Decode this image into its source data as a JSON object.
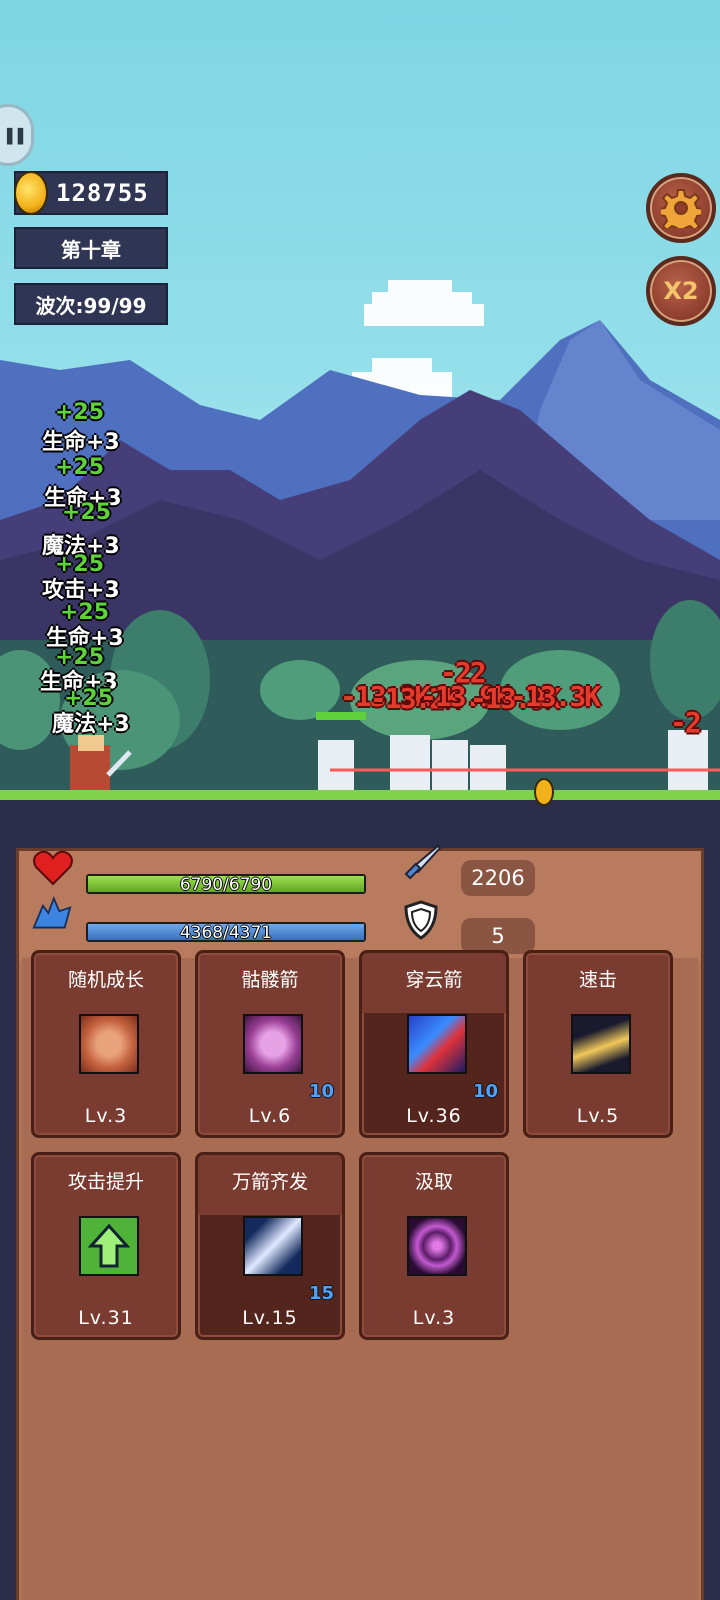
{
  "hud": {
    "coins": "128755",
    "chapter": "第十章",
    "wave": "波次:99/99",
    "speed_button": "X2"
  },
  "float_texts": [
    "+25",
    "生命+3",
    "+25",
    "生命+3",
    "+25",
    "魔法+3",
    "+25",
    "攻击+3",
    "+25",
    "生命+3",
    "+25",
    "生命+3",
    "+25",
    "魔法+3"
  ],
  "damage_texts": [
    "-22",
    "-13.3K",
    "-13.2K",
    "-13.9K",
    "-13.9K",
    "-13.3K",
    "-2"
  ],
  "stats": {
    "hp_text": "6790/6790",
    "hp_fraction": 1.0,
    "mp_text": "4368/4371",
    "mp_fraction": 0.999,
    "attack": "2206",
    "defense": "5"
  },
  "skills": [
    {
      "name": "随机成长",
      "level": "Lv.3",
      "badge": "",
      "icon": "fist-icon"
    },
    {
      "name": "骷髅箭",
      "level": "Lv.6",
      "badge": "10",
      "icon": "skull-icon"
    },
    {
      "name": "穿云箭",
      "level": "Lv.36",
      "badge": "10",
      "icon": "arrow-icon"
    },
    {
      "name": "速击",
      "level": "Lv.5",
      "badge": "",
      "icon": "swift-boot-icon"
    },
    {
      "name": "攻击提升",
      "level": "Lv.31",
      "badge": "",
      "icon": "up-arrow-icon"
    },
    {
      "name": "万箭齐发",
      "level": "Lv.15",
      "badge": "15",
      "icon": "feather-icon"
    },
    {
      "name": "汲取",
      "level": "Lv.3",
      "badge": "",
      "icon": "vortex-icon"
    }
  ],
  "colors": {
    "hp": "#7cc23a",
    "mp": "#4d86d4",
    "damage": "#e43b2c",
    "heal": "#5fd13a",
    "badge": "#4fa3ff"
  }
}
